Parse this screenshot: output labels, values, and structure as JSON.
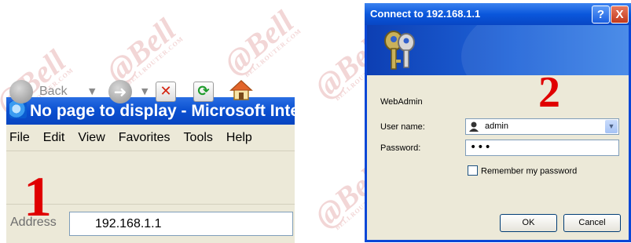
{
  "watermark": {
    "text": "@Bell",
    "subtext": "BELLROUTER.COM"
  },
  "browser": {
    "title": "No page to display - Microsoft Inte",
    "menu": [
      "File",
      "Edit",
      "View",
      "Favorites",
      "Tools",
      "Help"
    ],
    "toolbar": {
      "back_label": "Back"
    },
    "address": {
      "label": "Address",
      "value": "192.168.1.1"
    }
  },
  "step_markers": {
    "first": "1",
    "second": "2"
  },
  "dialog": {
    "title": "Connect to 192.168.1.1",
    "help_label": "?",
    "close_label": "X",
    "realm": "WebAdmin",
    "username_label": "User name:",
    "username_value": "admin",
    "password_label": "Password:",
    "password_mask": "•••",
    "remember_label": "Remember my password",
    "ok_label": "OK",
    "cancel_label": "Cancel"
  },
  "colors": {
    "xp_blue": "#0a57dc",
    "marker_red": "#e00000",
    "window_bg": "#ece9d8"
  }
}
